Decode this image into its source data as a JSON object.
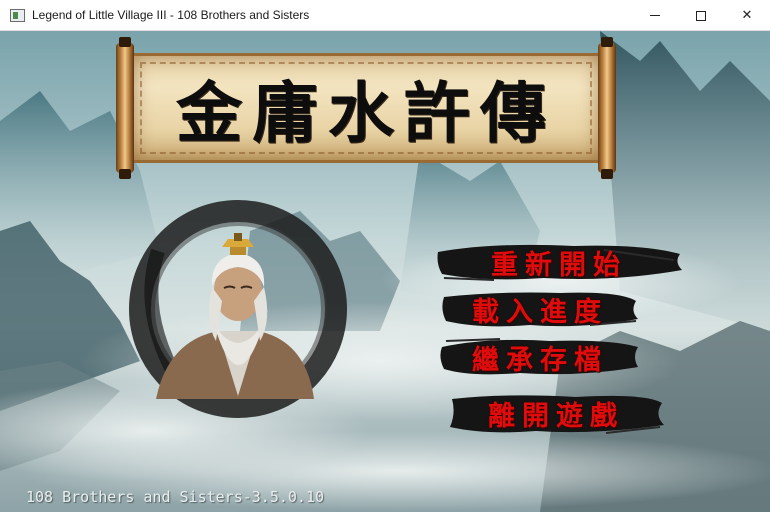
{
  "window": {
    "title": "Legend of Little Village III - 108 Brothers and Sisters",
    "minimize_glyph": "",
    "maximize_glyph": "",
    "close_glyph": "✕"
  },
  "logo": {
    "text": "金庸水許傳"
  },
  "menu": {
    "items": [
      {
        "label": "重新開始"
      },
      {
        "label": "載入進度"
      },
      {
        "label": "繼承存檔"
      },
      {
        "label": "離開遊戲"
      }
    ]
  },
  "version": {
    "text": "108 Brothers and Sisters-3.5.0.10"
  },
  "colors": {
    "menu_text": "#e00c0c",
    "ink_stroke": "#151515",
    "scroll_paper": "#f3e4c0",
    "scroll_rod": "#b37a3a"
  },
  "icons": {
    "app": "app-window-icon",
    "minimize": "minimize-icon",
    "maximize": "maximize-icon",
    "close": "close-icon"
  }
}
